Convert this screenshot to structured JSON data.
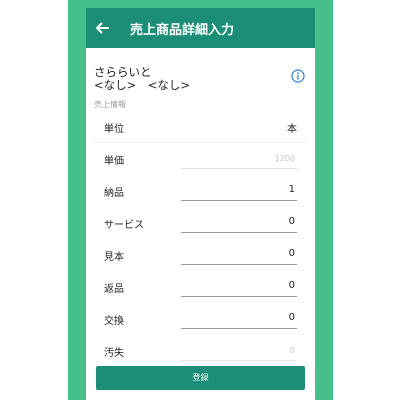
{
  "header": {
    "title": "売上商品詳細入力"
  },
  "customer": {
    "name": "さららいと",
    "line2": "<なし>　<なし>"
  },
  "section": {
    "label": "売上情報"
  },
  "fields": [
    {
      "label": "単位",
      "value": "本",
      "type": "static"
    },
    {
      "label": "単価",
      "value": "",
      "placeholder": "1200",
      "type": "input"
    },
    {
      "label": "納品",
      "value": "1",
      "type": "input"
    },
    {
      "label": "サービス",
      "value": "0",
      "type": "input"
    },
    {
      "label": "見本",
      "value": "0",
      "type": "input"
    },
    {
      "label": "返品",
      "value": "0",
      "type": "input"
    },
    {
      "label": "交換",
      "value": "0",
      "type": "input"
    },
    {
      "label": "汚失",
      "value": "",
      "placeholder": "0",
      "type": "input"
    }
  ],
  "actions": {
    "submit_label": "登録"
  },
  "colors": {
    "primary": "#1c8e78",
    "frame": "#46c08a",
    "info": "#2f7fd3"
  },
  "icons": {
    "back": "arrow-left",
    "info": "info-circle"
  }
}
